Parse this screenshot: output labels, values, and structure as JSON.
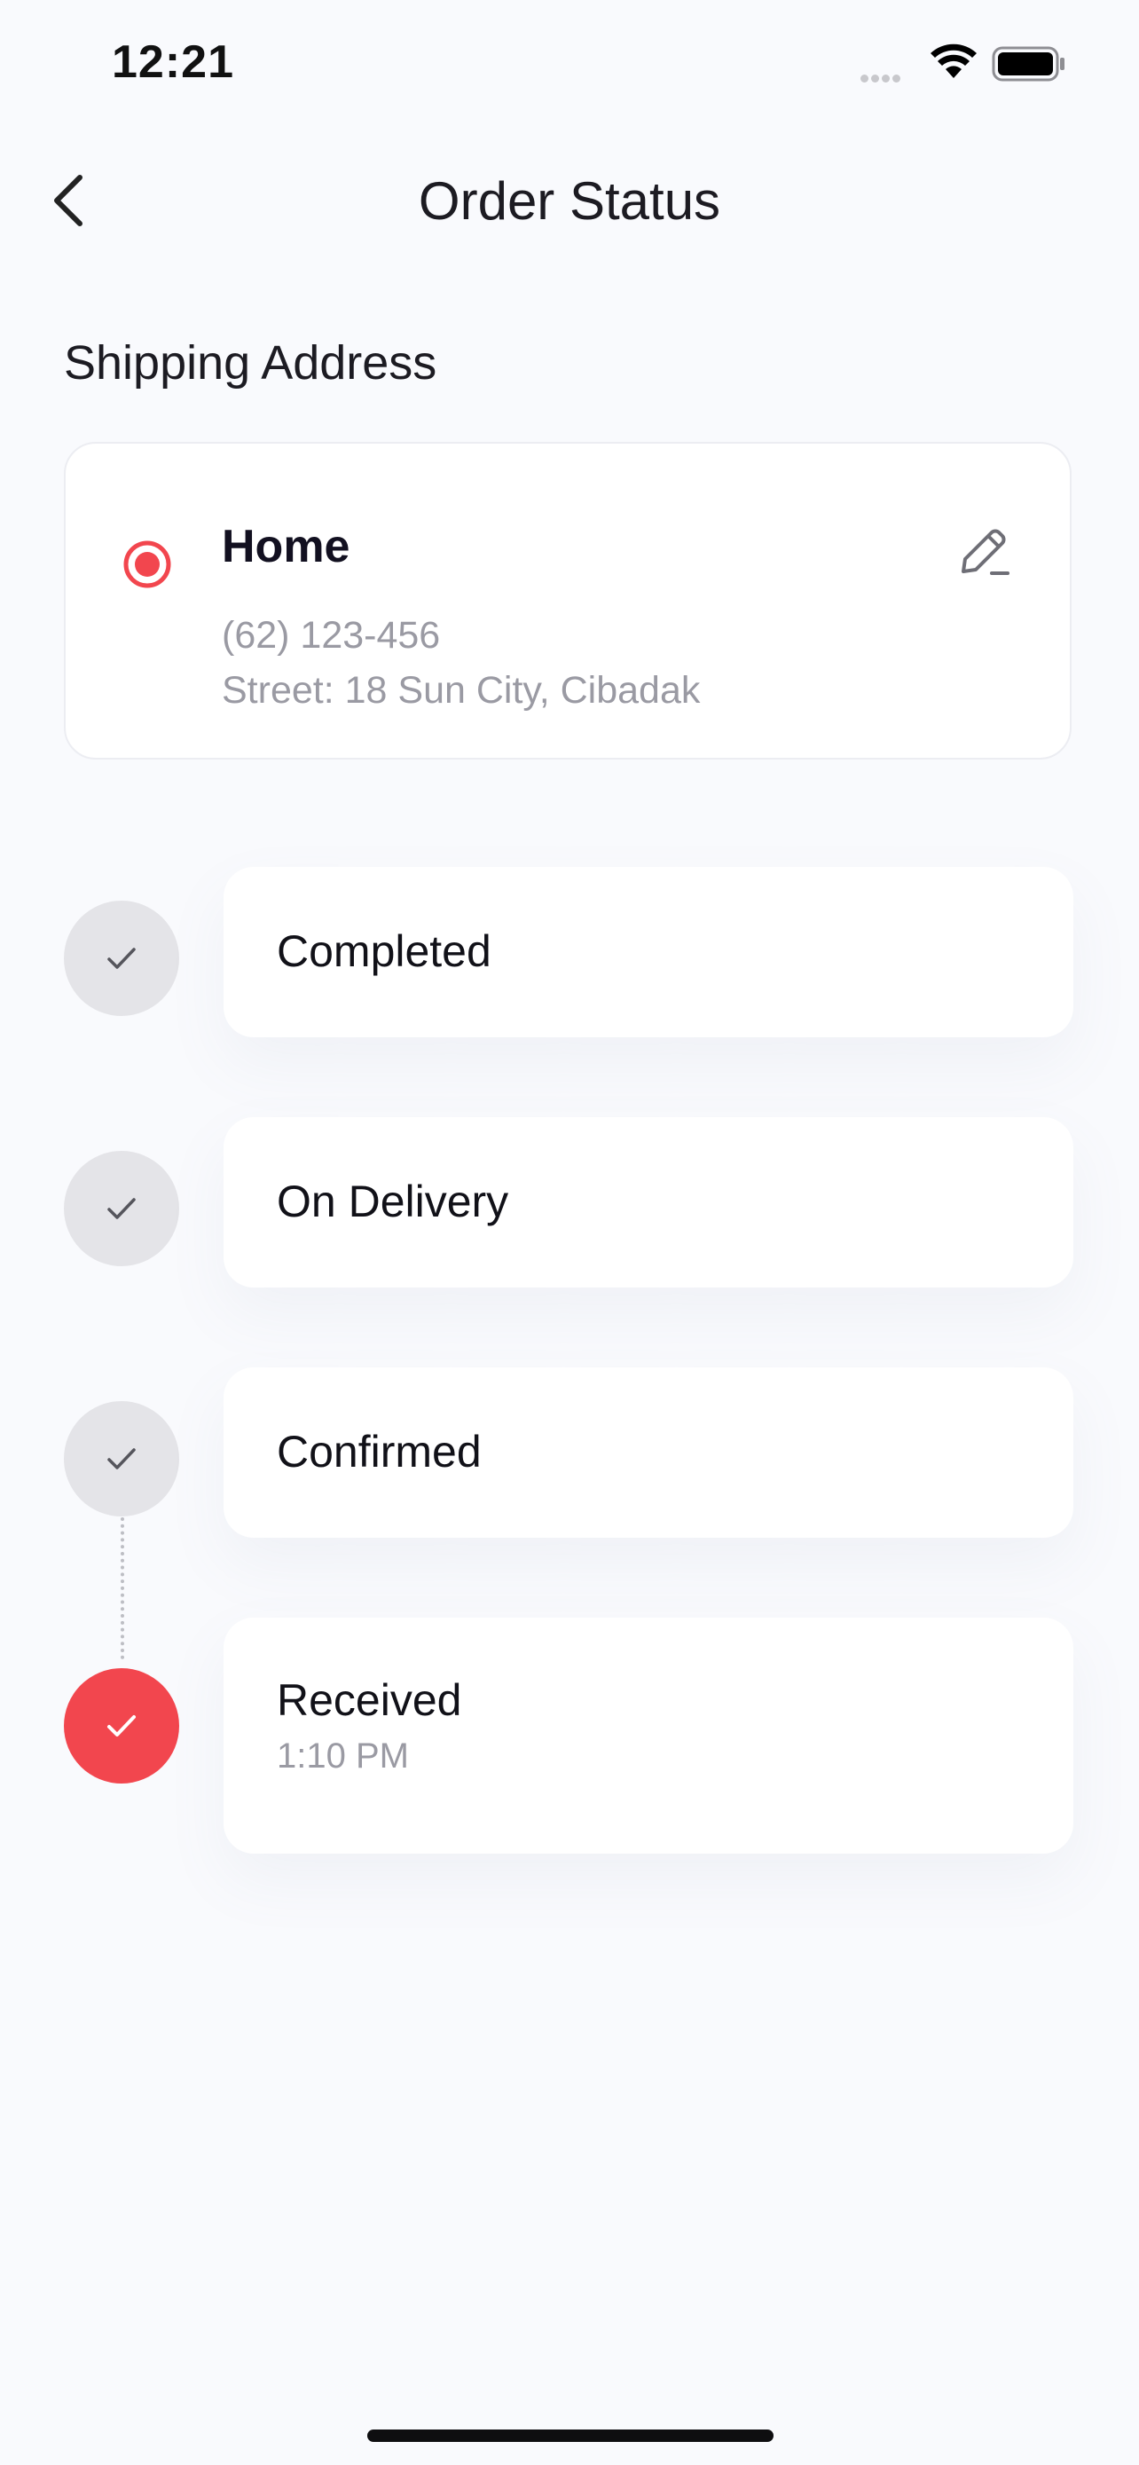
{
  "status_bar": {
    "time": "12:21"
  },
  "header": {
    "title": "Order Status"
  },
  "shipping": {
    "section_title": "Shipping Address",
    "address": {
      "name": "Home",
      "phone": "(62) 123-456",
      "street": "Street: 18 Sun City, Cibadak",
      "selected": true
    }
  },
  "timeline": {
    "steps": [
      {
        "label": "Completed",
        "time": "",
        "active": false
      },
      {
        "label": "On Delivery",
        "time": "",
        "active": false
      },
      {
        "label": "Confirmed",
        "time": "",
        "active": false
      },
      {
        "label": "Received",
        "time": "1:10 PM",
        "active": true
      }
    ]
  },
  "colors": {
    "accent": "#F2464E",
    "inactive_circle": "#E4E4E8",
    "muted_text": "#9A9AA3",
    "background": "#F9FAFD"
  },
  "icons": [
    "back-chevron-icon",
    "wifi-icon",
    "battery-icon",
    "cellular-signal-icon",
    "radio-selected-icon",
    "edit-pencil-icon",
    "check-icon"
  ]
}
